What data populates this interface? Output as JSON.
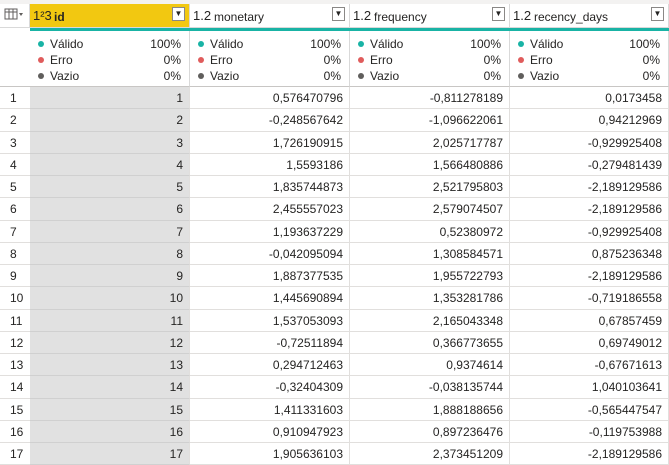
{
  "columns": [
    {
      "type": "1²3",
      "name": "id"
    },
    {
      "type": "1.2",
      "name": "monetary"
    },
    {
      "type": "1.2",
      "name": "frequency"
    },
    {
      "type": "1.2",
      "name": "recency_days"
    }
  ],
  "profile": {
    "valid_label": "Válido",
    "error_label": "Erro",
    "empty_label": "Vazio",
    "valid_pct": "100%",
    "error_pct": "0%",
    "empty_pct": "0%",
    "colors": {
      "valid": "#19b3a5",
      "error": "#e05c5c",
      "empty": "#605e5c"
    }
  },
  "rows": [
    {
      "n": "1",
      "id": "1",
      "monetary": "0,576470796",
      "frequency": "-0,811278189",
      "recency_days": "0,0173458"
    },
    {
      "n": "2",
      "id": "2",
      "monetary": "-0,248567642",
      "frequency": "-1,096622061",
      "recency_days": "0,94212969"
    },
    {
      "n": "3",
      "id": "3",
      "monetary": "1,726190915",
      "frequency": "2,025717787",
      "recency_days": "-0,929925408"
    },
    {
      "n": "4",
      "id": "4",
      "monetary": "1,5593186",
      "frequency": "1,566480886",
      "recency_days": "-0,279481439"
    },
    {
      "n": "5",
      "id": "5",
      "monetary": "1,835744873",
      "frequency": "2,521795803",
      "recency_days": "-2,189129586"
    },
    {
      "n": "6",
      "id": "6",
      "monetary": "2,455557023",
      "frequency": "2,579074507",
      "recency_days": "-2,189129586"
    },
    {
      "n": "7",
      "id": "7",
      "monetary": "1,193637229",
      "frequency": "0,52380972",
      "recency_days": "-0,929925408"
    },
    {
      "n": "8",
      "id": "8",
      "monetary": "-0,042095094",
      "frequency": "1,308584571",
      "recency_days": "0,875236348"
    },
    {
      "n": "9",
      "id": "9",
      "monetary": "1,887377535",
      "frequency": "1,955722793",
      "recency_days": "-2,189129586"
    },
    {
      "n": "10",
      "id": "10",
      "monetary": "1,445690894",
      "frequency": "1,353281786",
      "recency_days": "-0,719186558"
    },
    {
      "n": "11",
      "id": "11",
      "monetary": "1,537053093",
      "frequency": "2,165043348",
      "recency_days": "0,67857459"
    },
    {
      "n": "12",
      "id": "12",
      "monetary": "-0,72511894",
      "frequency": "0,366773655",
      "recency_days": "0,69749012"
    },
    {
      "n": "13",
      "id": "13",
      "monetary": "0,294712463",
      "frequency": "0,9374614",
      "recency_days": "-0,67671613"
    },
    {
      "n": "14",
      "id": "14",
      "monetary": "-0,32404309",
      "frequency": "-0,038135744",
      "recency_days": "1,040103641"
    },
    {
      "n": "15",
      "id": "15",
      "monetary": "1,411331603",
      "frequency": "1,888188656",
      "recency_days": "-0,565447547"
    },
    {
      "n": "16",
      "id": "16",
      "monetary": "0,910947923",
      "frequency": "0,897236476",
      "recency_days": "-0,119753988"
    },
    {
      "n": "17",
      "id": "17",
      "monetary": "1,905636103",
      "frequency": "2,373451209",
      "recency_days": "-2,189129586"
    }
  ]
}
